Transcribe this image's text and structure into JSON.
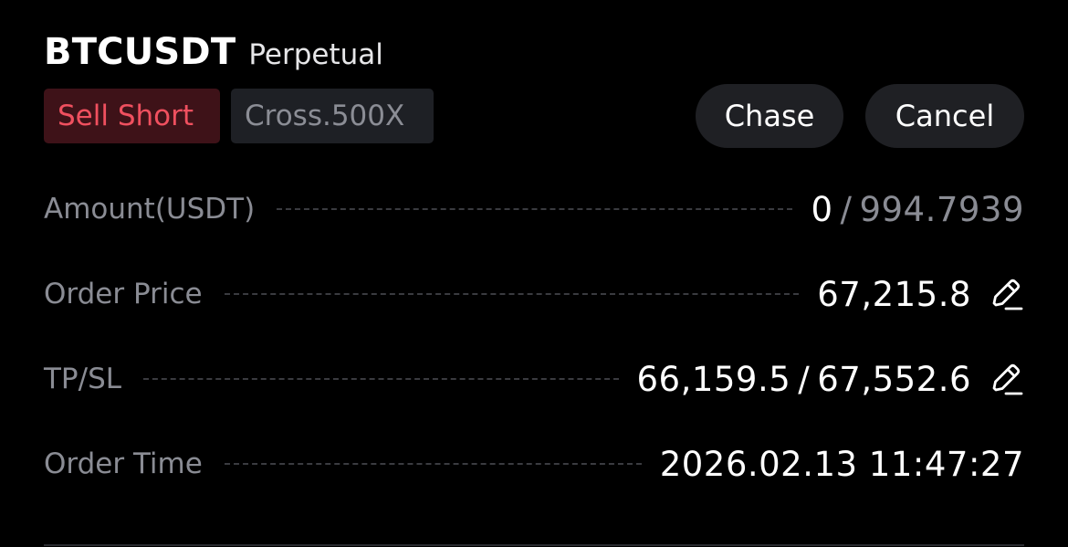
{
  "header": {
    "symbol": "BTCUSDT",
    "contract_type": "Perpetual"
  },
  "tags": {
    "side": "Sell Short",
    "margin": "Cross.500X"
  },
  "actions": {
    "chase_label": "Chase",
    "cancel_label": "Cancel"
  },
  "details": {
    "amount": {
      "label": "Amount(USDT)",
      "filled": "0",
      "separator": "/",
      "total": "994.7939"
    },
    "order_price": {
      "label": "Order Price",
      "value": "67,215.8",
      "icon": "pencil-edit-icon"
    },
    "tpsl": {
      "label": "TP/SL",
      "take_profit": "66,159.5",
      "separator": "/",
      "stop_loss": "67,552.6",
      "icon": "pencil-edit-icon"
    },
    "order_time": {
      "label": "Order Time",
      "value": "2026.02.13 11:47:27"
    }
  },
  "colors": {
    "background": "#000000",
    "sell_red": "#f0505f",
    "sell_bg": "#3e1218",
    "muted_text": "#8a8c94",
    "button_bg": "#1f2024"
  }
}
